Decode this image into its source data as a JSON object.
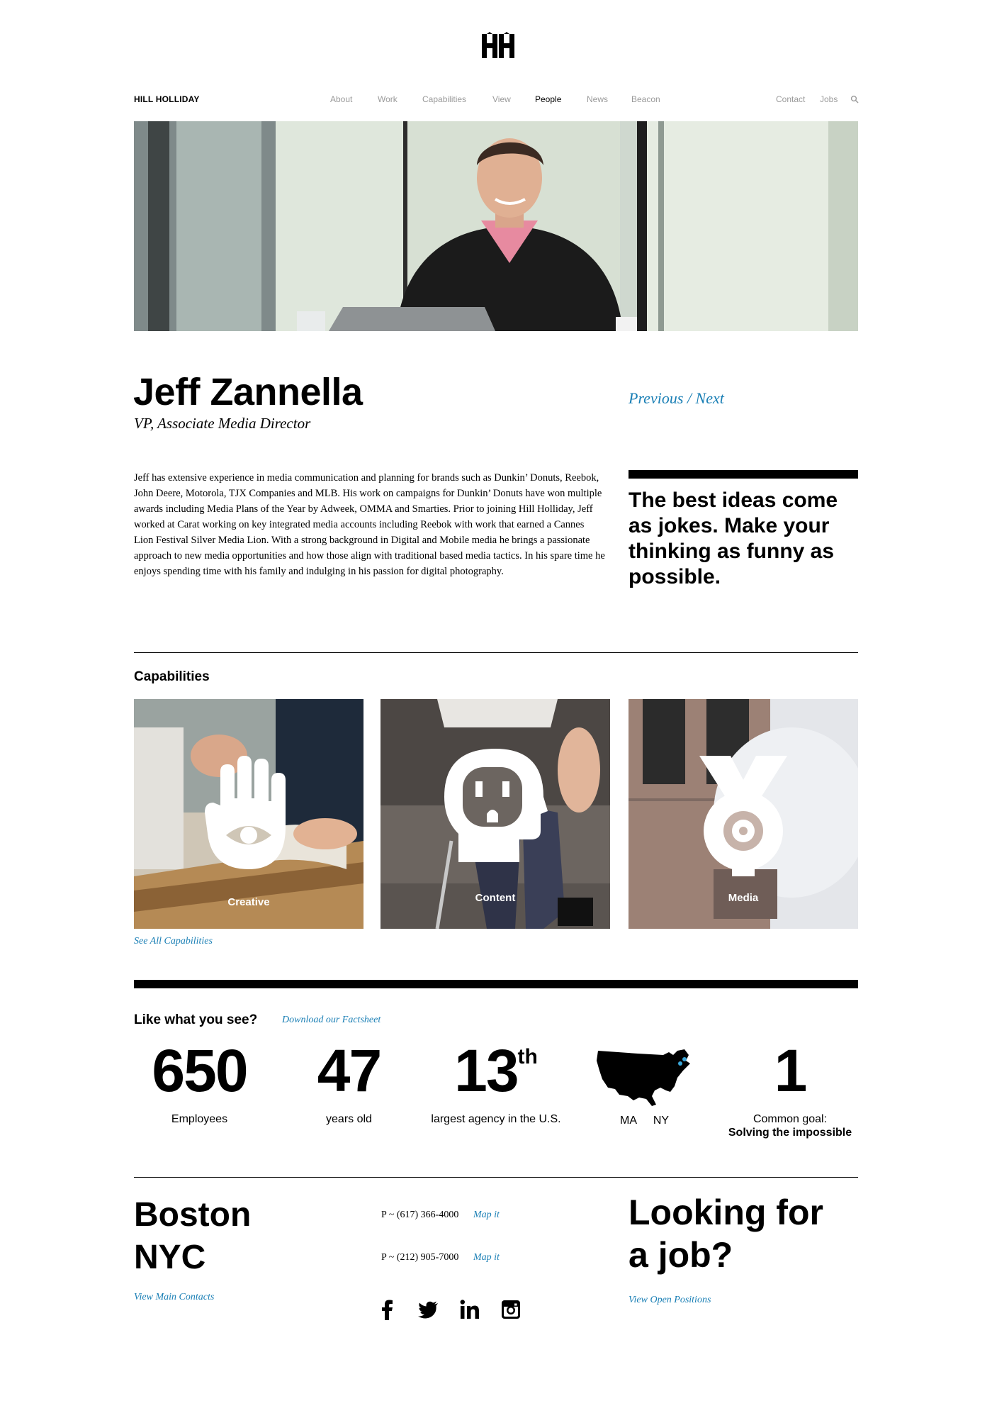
{
  "brand": {
    "logo_icon": "hh-logo-icon",
    "name": "HILL HOLLIDAY"
  },
  "nav": {
    "items": [
      {
        "label": "About"
      },
      {
        "label": "Work"
      },
      {
        "label": "Capabilities"
      },
      {
        "label": "View"
      },
      {
        "label": "People",
        "active": true
      },
      {
        "label": "News"
      },
      {
        "label": "Beacon"
      }
    ],
    "right": [
      {
        "label": "Contact"
      },
      {
        "label": "Jobs"
      }
    ],
    "search_icon": "search-icon"
  },
  "profile": {
    "name": "Jeff Zannella",
    "title": "VP, Associate Media Director",
    "previous": "Previous",
    "separator": "/",
    "next": "Next",
    "bio": "Jeff has extensive experience in media communication and planning for brands such as Dunkin’ Donuts, Reebok, John Deere, Motorola, TJX Companies and MLB. His work on campaigns for Dunkin’ Donuts have won multiple awards including Media Plans of the Year by Adweek, OMMA and Smarties. Prior to joining Hill Holliday, Jeff worked at Carat working on key integrated media accounts including Reebok with work that earned a Cannes Lion Festival Silver Media Lion. With a strong background in Digital and Mobile media he brings a passionate approach to new media opportunities and how those align with traditional based media tactics. In his spare time he enjoys spending time with his family and indulging in his passion for digital photography.",
    "quote": "The best ideas come as jokes. Make your thinking as funny as possible."
  },
  "capabilities": {
    "heading": "Capabilities",
    "items": [
      {
        "label": "Creative",
        "icon": "hand-eye-icon"
      },
      {
        "label": "Content",
        "icon": "head-outlet-icon"
      },
      {
        "label": "Media",
        "icon": "target-icon"
      }
    ],
    "see_all": "See All Capabilities"
  },
  "stats": {
    "heading": "Like what you see?",
    "factsheet": "Download our Factsheet",
    "items": [
      {
        "value": "650",
        "label": "Employees"
      },
      {
        "value": "47",
        "label": "years old"
      },
      {
        "value": "13",
        "suffix": "th",
        "label": "largest agency in the U.S."
      },
      {
        "icon": "us-map-icon",
        "label_a": "MA",
        "label_b": "NY"
      },
      {
        "value": "1",
        "label": "Common goal:",
        "label_strong": "Solving the impossible"
      }
    ]
  },
  "footer": {
    "city1": "Boston",
    "city2": "NYC",
    "contacts": "View Main Contacts",
    "phone1": "P ~ (617) 366-4000",
    "phone2": "P ~ (212) 905-7000",
    "map": "Map it",
    "job_line1": "Looking for",
    "job_line2": "a job?",
    "open_positions": "View Open Positions",
    "social": [
      "facebook-icon",
      "twitter-icon",
      "linkedin-icon",
      "instagram-icon"
    ]
  },
  "colors": {
    "accent": "#1a7fb5",
    "text": "#000000",
    "nav_muted": "#9a9a9a",
    "map_highlight": "#3aa6d8"
  }
}
